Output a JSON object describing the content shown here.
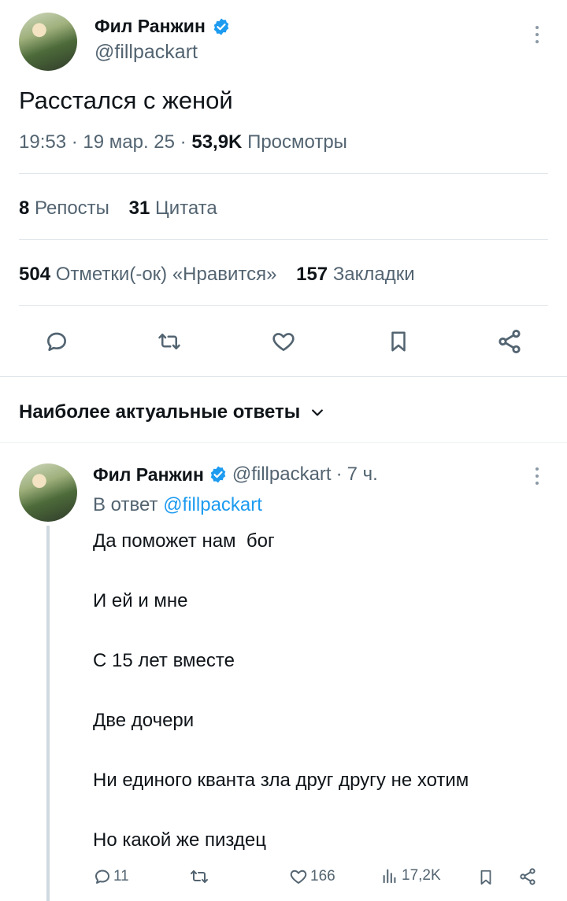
{
  "tweet": {
    "author_name": "Фил Ранжин",
    "author_handle": "@fillpackart",
    "text": "Расстался с женой",
    "time": "19:53",
    "date": "19 мар. 25",
    "views_count": "53,9K",
    "views_label": "Просмотры",
    "reposts_count": "8",
    "reposts_label": "Репосты",
    "quotes_count": "31",
    "quotes_label": "Цитата",
    "likes_count": "504",
    "likes_label": "Отметки(-ок) «Нравится»",
    "bookmarks_count": "157",
    "bookmarks_label": "Закладки"
  },
  "replies_header": {
    "label": "Наиболее актуальные ответы"
  },
  "reply": {
    "author_name": "Фил Ранжин",
    "author_handle": "@fillpackart",
    "age": "7 ч.",
    "in_reply_prefix": "В ответ",
    "in_reply_handle": "@fillpackart",
    "lines": [
      "Да поможет нам  бог",
      "И ей и мне",
      "С 15 лет вместе",
      "Две дочери",
      "Ни единого кванта зла друг другу не хотим",
      "Но какой же пиздец"
    ],
    "replies_count": "11",
    "likes_count": "166",
    "views_count": "17,2K"
  },
  "colors": {
    "accent": "#1d9bf0",
    "text": "#0f1419",
    "secondary": "#536471"
  }
}
